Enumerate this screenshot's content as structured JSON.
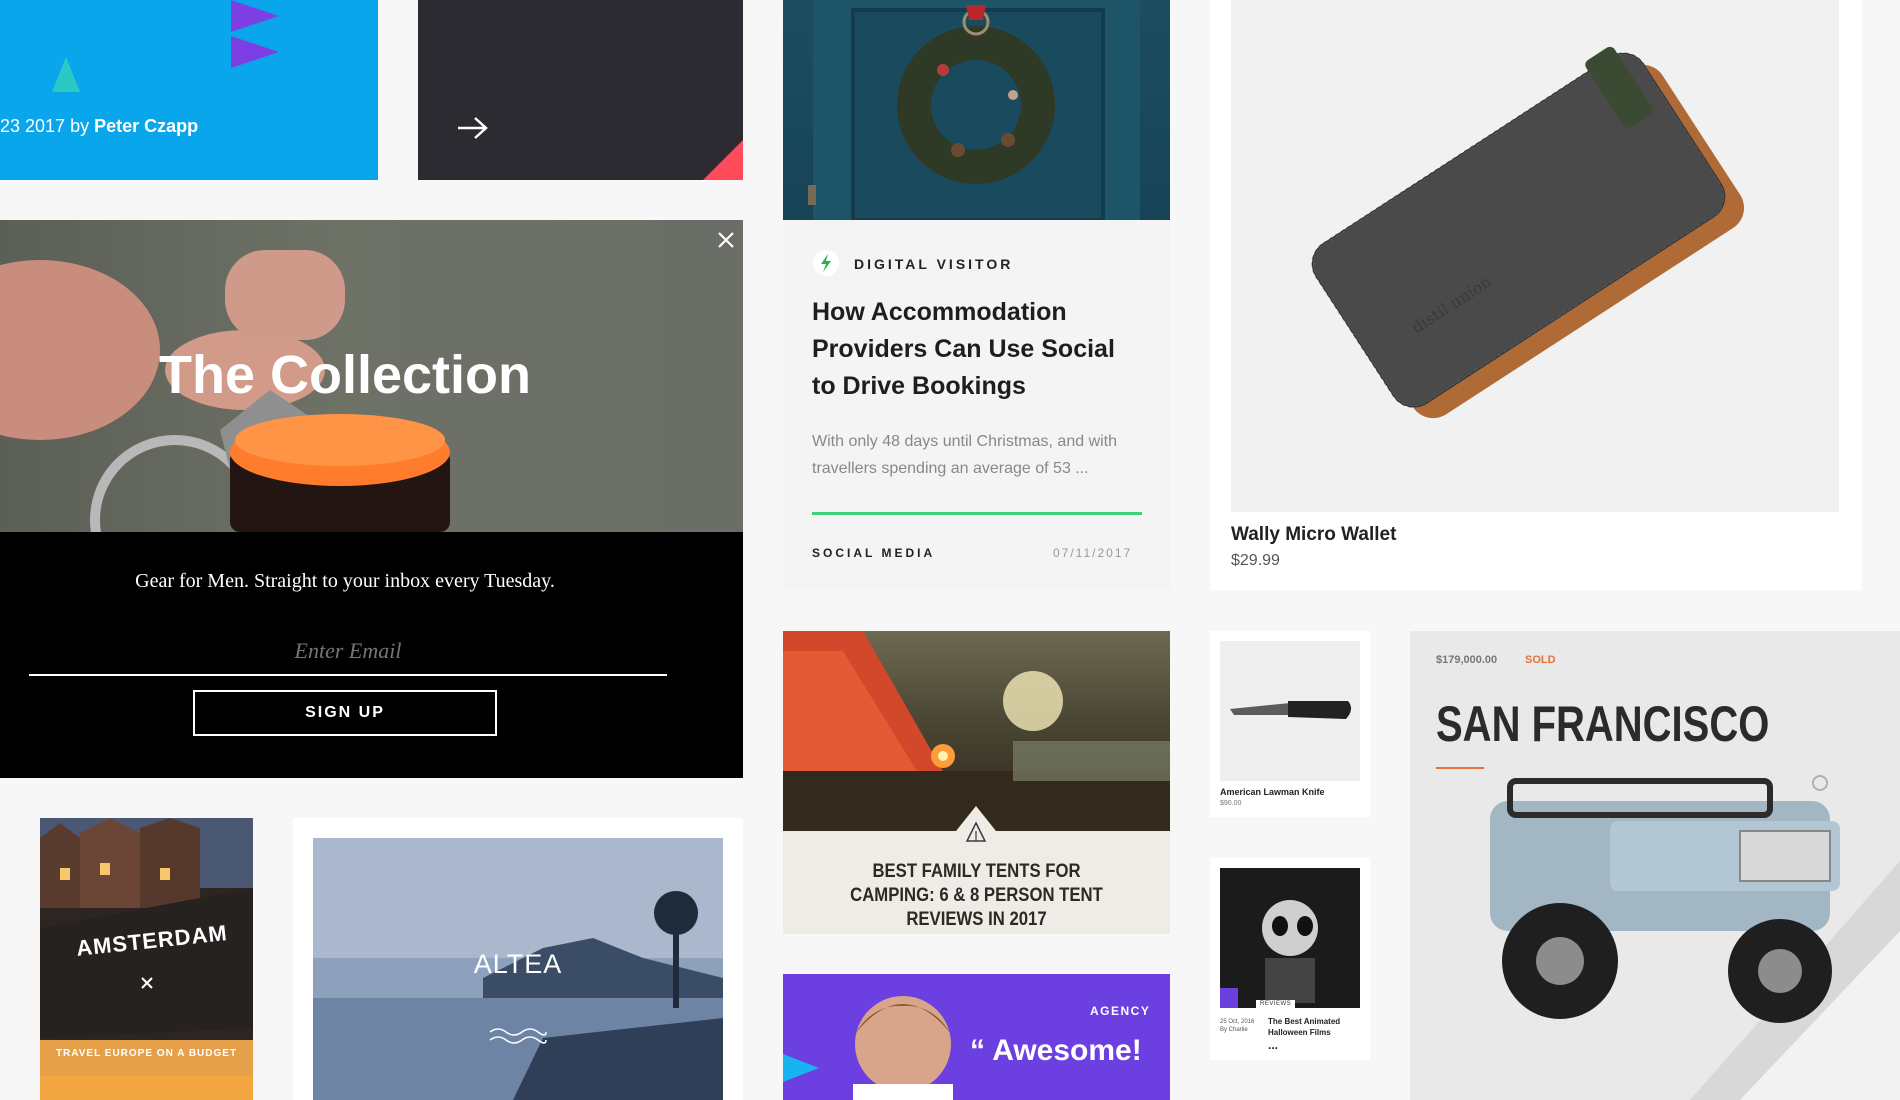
{
  "blog_card": {
    "date_prefix": "23 2017 by",
    "author": "Peter Czapp"
  },
  "dark_card": {
    "arrow_icon": "arrow-right-icon"
  },
  "newsletter": {
    "title": "The Collection",
    "tagline": "Gear for Men. Straight to your inbox every Tuesday.",
    "email_placeholder": "Enter Email",
    "signup_label": "SIGN UP",
    "close_icon": "close-icon"
  },
  "article": {
    "publisher": "DIGITAL VISITOR",
    "title": "How Accommodation Providers Can Use Social to Drive Bookings",
    "excerpt": "With only 48 days until Christmas, and with travellers spending an average of 53 ...",
    "category": "SOCIAL MEDIA",
    "date": "07/11/2017",
    "accent_color": "#3fd07a"
  },
  "product": {
    "name": "Wally Micro Wallet",
    "price": "$29.99",
    "brand_mark": "distil union"
  },
  "tent_post": {
    "title": "BEST FAMILY TENTS FOR CAMPING: 6 & 8 PERSON TENT REVIEWS IN 2017"
  },
  "agency_card": {
    "label": "AGENCY",
    "quote": "“ Awesome!"
  },
  "knife": {
    "name": "American Lawman Knife",
    "price": "$90.00"
  },
  "movie": {
    "section": "REVIEWS",
    "date": "25 Oct, 2016",
    "byline": "By Charlie",
    "title": "The Best Animated Halloween Films",
    "more": "..."
  },
  "listing": {
    "price": "$179,000.00",
    "status": "SOLD",
    "city": "SAN FRANCISCO",
    "status_color": "#e8703a"
  },
  "travel": {
    "city": "AMSTERDAM",
    "subtitle": "TRAVEL EUROPE ON A BUDGET",
    "close_icon": "close-icon"
  },
  "altea": {
    "title": "ALTEA"
  }
}
